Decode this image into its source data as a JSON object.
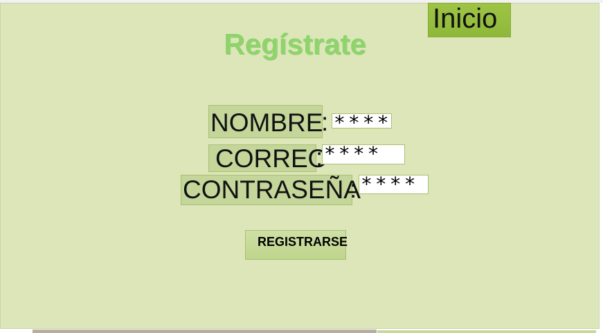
{
  "header": {
    "home_link": "Inicio",
    "title": "Regístrate"
  },
  "form": {
    "fields": [
      {
        "label": "NOMBRE",
        "separator": ":",
        "value": "****"
      },
      {
        "label": "CORREO",
        "separator": ":",
        "value": "****"
      },
      {
        "label": "CONTRASEÑA",
        "separator": ":",
        "value": "****"
      }
    ],
    "submit_label": "REGISTRARSE"
  },
  "colors": {
    "background": "#dce6b8",
    "home_button": "#9ec445",
    "title": "#8fd36a",
    "label_box": "#c4d69a"
  }
}
